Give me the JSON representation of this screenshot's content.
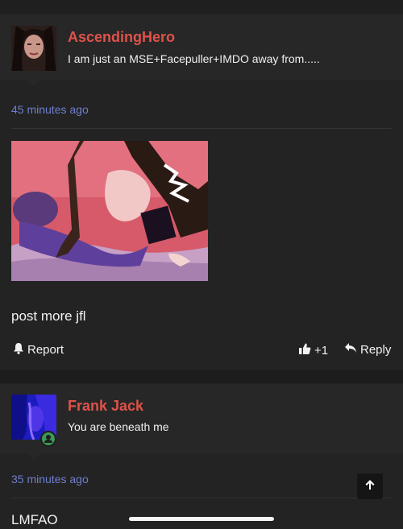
{
  "comments": [
    {
      "username": "AscendingHero",
      "text": "I am just an MSE+Facepuller+IMDO away from.....",
      "time": "45 minutes ago",
      "has_image": true,
      "body": "post more jfl",
      "actions": {
        "report": "Report",
        "likes": "+1",
        "reply": "Reply"
      }
    },
    {
      "username": "Frank Jack",
      "text": "You are beneath me",
      "time": "35 minutes ago",
      "body": "LMFAO",
      "online": true
    }
  ],
  "colors": {
    "username": "#e0524a",
    "timestamp": "#6f7fcf",
    "background": "#232323",
    "online": "#3b9b55"
  },
  "icons": [
    "bell-icon",
    "thumbs-up-icon",
    "reply-arrow-icon",
    "user-status-icon",
    "arrow-up-icon"
  ]
}
